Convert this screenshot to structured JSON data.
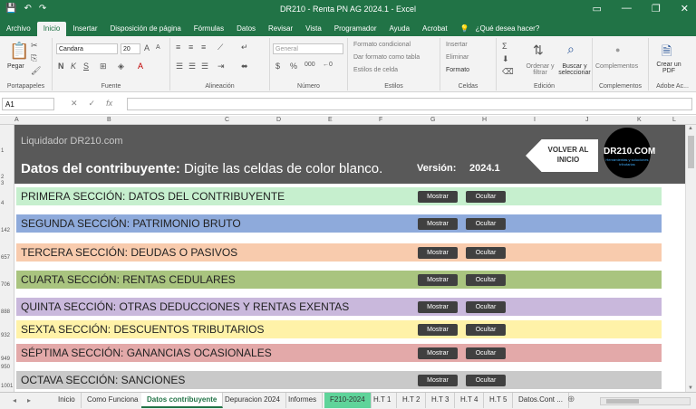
{
  "window": {
    "title": "DR210 - Renta PN AG 2024.1  -  Excel",
    "quick_access": [
      "💾",
      "↶",
      "↷"
    ],
    "controls": [
      "▭",
      "—",
      "❐",
      "✕"
    ]
  },
  "menu": {
    "tabs": [
      "Archivo",
      "Inicio",
      "Insertar",
      "Disposición de página",
      "Fórmulas",
      "Datos",
      "Revisar",
      "Vista",
      "Programador",
      "Ayuda",
      "Acrobat",
      "💡",
      "¿Qué desea hacer?"
    ],
    "active_index": 1
  },
  "ribbon": {
    "clipboard": {
      "paste": "Pegar",
      "label": "Portapapeles"
    },
    "font": {
      "name": "Candara",
      "size": "20",
      "bold": "N",
      "italic": "K",
      "underline": "S",
      "label": "Fuente"
    },
    "alignment": {
      "label": "Alineación"
    },
    "number": {
      "format": "General",
      "currency": "$",
      "percent": "%",
      "thousands": "000",
      "label": "Número"
    },
    "styles": {
      "conditional": "Formato condicional",
      "table": "Dar formato como tabla",
      "cell": "Estilos de celda",
      "label": "Estilos"
    },
    "cells": {
      "insert": "Insertar",
      "delete": "Eliminar",
      "format": "Formato",
      "label": "Celdas"
    },
    "editing": {
      "sort": "Ordenar y filtrar",
      "find": "Buscar y seleccionar",
      "label": "Edición"
    },
    "addins": {
      "button": "Complementos",
      "label": "Complementos"
    },
    "adobe": {
      "button": "Crear un PDF",
      "label": "Adobe Ac..."
    }
  },
  "formula_bar": {
    "name_box": "A1",
    "fx": "fx",
    "value": ""
  },
  "columns": [
    "A",
    "B",
    "C",
    "D",
    "E",
    "F",
    "G",
    "H",
    "I",
    "J",
    "K",
    "L"
  ],
  "rows": [
    "1",
    "2",
    "3",
    "4",
    "142",
    "657",
    "706",
    "888",
    "932",
    "949",
    "950",
    "1001"
  ],
  "banner": {
    "brand": "Liquidador DR210.com",
    "heading_bold": "Datos del contribuyente:",
    "heading_rest": " Digite las celdas de color blanco.",
    "version_label": "Versión:",
    "version_value": "2024.1",
    "back_button": "VOLVER AL INICIO",
    "logo_text": "DR210.COM",
    "logo_sub": "Herramientas y soluciones tributarias"
  },
  "sections": [
    {
      "title": "PRIMERA SECCIÓN: DATOS DEL CONTRIBUYENTE",
      "color": "#c6efce"
    },
    {
      "title": "SEGUNDA SECCIÓN: PATRIMONIO BRUTO",
      "color": "#8eaadb"
    },
    {
      "title": "TERCERA SECCIÓN: DEUDAS O PASIVOS",
      "color": "#f8cbad"
    },
    {
      "title": "CUARTA SECCIÓN: RENTAS CEDULARES",
      "color": "#a9c47f"
    },
    {
      "title": "QUINTA SECCIÓN: OTRAS DEDUCCIONES Y RENTAS EXENTAS",
      "color": "#c9b8dc"
    },
    {
      "title": "SEXTA SECCIÓN: DESCUENTOS TRIBUTARIOS",
      "color": "#fff2a8"
    },
    {
      "title": "SÉPTIMA SECCIÓN: GANANCIAS OCASIONALES",
      "color": "#e3a9a9"
    },
    {
      "title": "OCTAVA SECCIÓN: SANCIONES",
      "color": "#c9c9c9"
    }
  ],
  "section_buttons": {
    "show": "Mostrar",
    "hide": "Ocultar"
  },
  "sheet_tabs": [
    "Inicio",
    "Como Funciona",
    "Datos contribuyente",
    "Depuracion 2024",
    "Informes",
    "F210-2024",
    "H.T 1",
    "H.T 2",
    "H.T 3",
    "H.T 4",
    "H.T 5",
    "Datos.Cont ..."
  ],
  "sheet_tab_active": 2,
  "sheet_tab_green": 5,
  "add_sheet": "⊕",
  "colors": {
    "excel_green": "#217346",
    "banner": "#595959",
    "button": "#404040"
  }
}
